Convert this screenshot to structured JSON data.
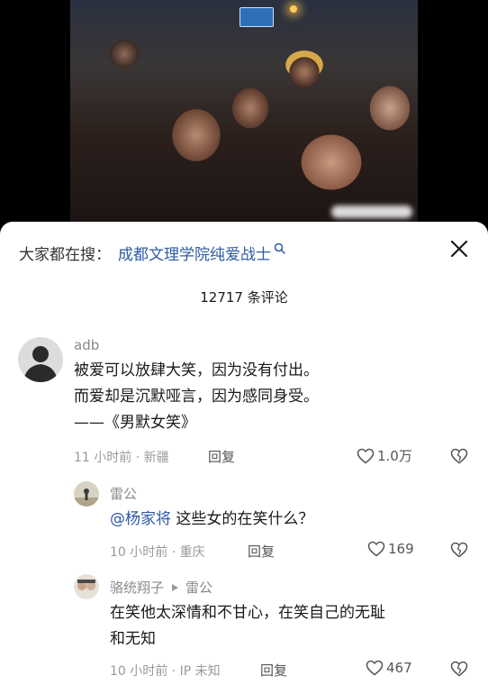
{
  "search": {
    "prefix": "大家都在搜：",
    "query": "成都文理学院纯爱战士"
  },
  "comment_count": "12717 条评论",
  "comments": [
    {
      "username": "adb",
      "lines": [
        "被爱可以放肆大笑，因为没有付出。",
        "而爱却是沉默哑言，因为感同身受。",
        "——《男默女笑》"
      ],
      "time_location": "11 小时前 · 新疆",
      "reply_label": "回复",
      "likes": "1.0万"
    },
    {
      "username": "雷公",
      "mention": "@杨家将",
      "text": " 这些女的在笑什么？",
      "time_location": "10 小时前 · 重庆",
      "reply_label": "回复",
      "likes": "169"
    },
    {
      "username": "骆统翔子",
      "reply_to": "雷公",
      "lines": [
        "在笑他太深情和不甘心，在笑自己的无耻",
        "和无知"
      ],
      "time_location": "10 小时前 · IP 未知",
      "reply_label": "回复",
      "likes": "467"
    }
  ],
  "colors": {
    "link": "#2e5aa8",
    "muted": "#9a9a9a"
  },
  "icons": [
    "search-icon",
    "close-icon",
    "heart-icon",
    "broken-heart-icon",
    "play-triangle-icon"
  ]
}
